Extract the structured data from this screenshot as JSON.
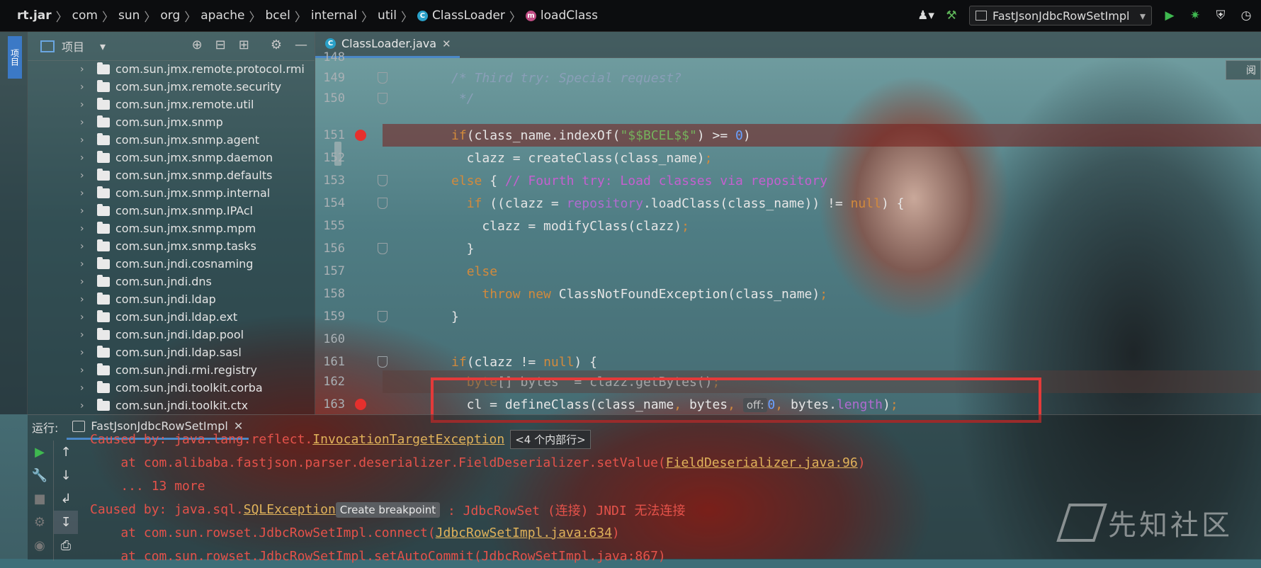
{
  "breadcrumb": {
    "items": [
      "rt.jar",
      "com",
      "sun",
      "org",
      "apache",
      "bcel",
      "internal",
      "util"
    ],
    "class_name": "ClassLoader",
    "method_name": "loadClass"
  },
  "toolbar": {
    "run_config": "FastJsonJdbcRowSetImpl",
    "icons": [
      "user-icon",
      "hammer-icon",
      "run-icon",
      "debug-icon",
      "coverage-icon",
      "profile-icon"
    ]
  },
  "left_strip": {
    "tab_label": "项目"
  },
  "project_panel": {
    "title": "项目",
    "items": [
      "com.sun.jmx.remote.protocol.rmi",
      "com.sun.jmx.remote.security",
      "com.sun.jmx.remote.util",
      "com.sun.jmx.snmp",
      "com.sun.jmx.snmp.agent",
      "com.sun.jmx.snmp.daemon",
      "com.sun.jmx.snmp.defaults",
      "com.sun.jmx.snmp.internal",
      "com.sun.jmx.snmp.IPAcl",
      "com.sun.jmx.snmp.mpm",
      "com.sun.jmx.snmp.tasks",
      "com.sun.jndi.cosnaming",
      "com.sun.jndi.dns",
      "com.sun.jndi.ldap",
      "com.sun.jndi.ldap.ext",
      "com.sun.jndi.ldap.pool",
      "com.sun.jndi.ldap.sasl",
      "com.sun.jndi.rmi.registry",
      "com.sun.jndi.toolkit.corba",
      "com.sun.jndi.toolkit.ctx"
    ]
  },
  "editor": {
    "tab_label": "ClassLoader.java",
    "read_mode_label": "阅",
    "line_numbers": [
      "148",
      "149",
      "150",
      "151",
      "152",
      "153",
      "154",
      "155",
      "156",
      "157",
      "158",
      "159",
      "160",
      "161",
      "162",
      "163"
    ],
    "inlay_hint": "off:"
  },
  "run_panel": {
    "label": "运行:",
    "tab_label": "FastJsonJdbcRowSetImpl",
    "console": {
      "l1_text": "Caused by: java.lang.reflect.",
      "l1_link": "InvocationTargetException",
      "l1_chip": "<4 个内部行>",
      "l2_text": "    at com.alibaba.fastjson.parser.deserializer.FieldDeserializer.setValue(",
      "l2_link": "FieldDeserializer.java:96",
      "l2_end": ")",
      "l3_text": "    ... 13 more",
      "l4_text": "Caused by: java.sql.",
      "l4_link": "SQLException",
      "l4_chip": "Create breakpoint",
      "l4_end": " : JdbcRowSet (连接) JNDI 无法连接",
      "l5_text": "    at com.sun.rowset.JdbcRowSetImpl.connect(",
      "l5_link": "JdbcRowSetImpl.java:634",
      "l5_end": ")",
      "l6_text": "    at com.sun.rowset.JdbcRowSetImpl.setAutoCommit(JdbcRowSetImpl.java:867)"
    }
  },
  "watermark": {
    "text": "先知社区"
  },
  "colors": {
    "accent": "#4a88c7",
    "breakpoint": "#e5302d",
    "highlight_box": "#e33a3a"
  }
}
